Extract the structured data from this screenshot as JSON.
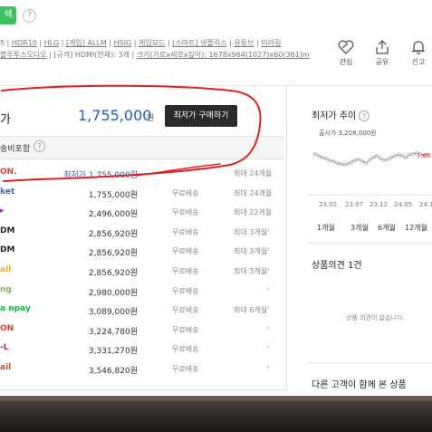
{
  "top": {
    "search_label": "색",
    "help_glyph": "?"
  },
  "specs": {
    "line1": [
      "5",
      "HDR10",
      "HLG",
      "[게임] ALLM",
      "HSIG",
      "게임모드",
      "[스마트] 넷플릭스",
      "유튜브",
      "미러링"
    ],
    "line2_parts": [
      "블루투스오디오",
      "[규격] HDMI(전체): 3개",
      "크기(가로x세로x깊이): 1678x964(1027)x60(361)m"
    ]
  },
  "actions": [
    {
      "label": "관심",
      "icon": "heart-icon"
    },
    {
      "label": "공유",
      "icon": "share-icon"
    },
    {
      "label": "신고",
      "icon": "bell-icon"
    }
  ],
  "lowest": {
    "label": "가",
    "price": "1,755,000",
    "unit": "원",
    "buy_label": "최저가 구매하기"
  },
  "shipping_tab": {
    "label": "송비포함",
    "help": "?"
  },
  "sellers": [
    {
      "logo": "ON.",
      "logo_color": "#e0402a",
      "price": "최저가 1,755,000원",
      "ship": "",
      "inst": "최대 24개월"
    },
    {
      "logo": "ket",
      "logo_color": "#2d6fd6",
      "price": "1,755,000원",
      "ship": "무료배송",
      "inst": "최대 24개월"
    },
    {
      "logo": "▸",
      "logo_color": "#9a2fb8",
      "price": "2,496,000원",
      "ship": "무료배송",
      "inst": "최대 22개월"
    },
    {
      "logo": "DM",
      "logo_color": "#222222",
      "price": "2,856,920원",
      "ship": "무료배송",
      "inst": "최대 3개월"
    },
    {
      "logo": "DM",
      "logo_color": "#222222",
      "price": "2,856,920원",
      "ship": "무료배송",
      "inst": "최대 3개월"
    },
    {
      "logo": "all",
      "logo_color": "#f1b51c",
      "price": "2,856,920원",
      "ship": "무료배송",
      "inst": "최대 3개월"
    },
    {
      "logo": "ng",
      "logo_color": "#7db64a",
      "price": "2,980,000원",
      "ship": "무료배송",
      "inst": ""
    },
    {
      "logo": "a npay",
      "logo_color": "#21b24b",
      "price": "3,089,000원",
      "ship": "무료배송",
      "inst": "최대 6개월"
    },
    {
      "logo": "ON",
      "logo_color": "#e0402a",
      "price": "3,224,780원",
      "ship": "무료배송",
      "inst": ""
    },
    {
      "logo": "-L",
      "logo_color": "#d8242b",
      "price": "3,331,270원",
      "ship": "무료배송",
      "inst": ""
    },
    {
      "logo": "ail",
      "logo_color": "#e0402a",
      "price": "3,546,820원",
      "ship": "무료배송",
      "inst": ""
    }
  ],
  "trend": {
    "title": "최저가 추이",
    "help": "?",
    "release_price": "출시가 3,208,000원",
    "peak_label": "1,68",
    "x_ticks": [
      "23.02",
      "23.07",
      "23.12",
      "24.05",
      "24.1"
    ],
    "periods": [
      "1개월",
      "3개월",
      "6개월",
      "12개월"
    ]
  },
  "reviews": {
    "title": "상품의견 1건",
    "empty": "상품 의견이 없습니다."
  },
  "also_viewed": {
    "title": "다른 고객이 함께 본 상품"
  },
  "colors": {
    "accent_green": "#3ec25c",
    "price_blue": "#1d5fc4",
    "annotation_red": "#e02020"
  }
}
